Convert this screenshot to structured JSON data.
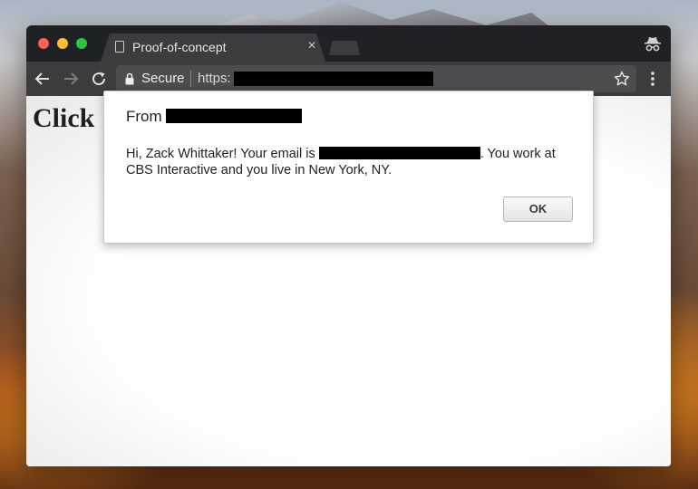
{
  "browser": {
    "tab": {
      "title": "Proof-of-concept",
      "close_glyph": "×",
      "icon": "page-icon"
    },
    "toolbar": {
      "security_label": "Secure",
      "url_prefix": "https:",
      "icons": [
        "back-arrow-icon",
        "forward-arrow-icon",
        "reload-icon",
        "lock-icon",
        "star-icon",
        "menu-icon"
      ]
    },
    "incognito_icon": "incognito-icon"
  },
  "page": {
    "heading": "Click"
  },
  "dialog": {
    "from_label": "From",
    "message_part1": "Hi, Zack Whittaker! Your email is ",
    "message_part2": ". You work at CBS Interactive and you live in New York, NY.",
    "ok_label": "OK"
  },
  "colors": {
    "titlebar": "#202124",
    "toolbar": "#3c3c3e",
    "redaction": "#000000",
    "close_dot": "#fc5f57",
    "minimize_dot": "#fdbc2e",
    "maximize_dot": "#27c840"
  }
}
